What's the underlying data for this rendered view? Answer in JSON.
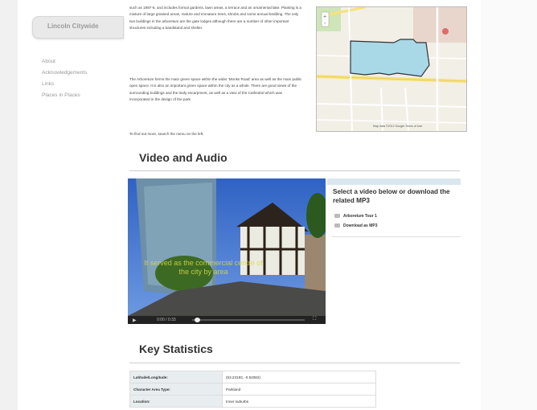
{
  "sidebar": {
    "brand": "Lincoln Citywide",
    "items": [
      {
        "label": "About"
      },
      {
        "label": "Acknowledgements"
      },
      {
        "label": "Links"
      },
      {
        "label": "Places in Places"
      }
    ]
  },
  "intro": {
    "p1": "such as 1997-8, and includes formal gardens, lawn areas, a terrace and an ornamental lake. Planting is a mixture of large grassed areas, mature and immature trees, shrubs and some annual bedding. The only two buildings in the arboretum are the gate lodges although there are a number of other important structures including a bandstand and shelter.",
    "p2": "The Arboretum forms the main green space within the wider 'Monks Road' area as well as the main public open space. It is also an important green space within the city as a whole. There are good views of the surrounding buildings and the leafy escarpment, as well as a view of the Cathedral which was incorporated in the design of the park.",
    "p3": "To find out more, search the menu on the left."
  },
  "map": {
    "attribution": "Map data ©2012 Google  Terms of Use"
  },
  "video_section": {
    "title": "Video and Audio",
    "panel_title": "Select a video below or download the related MP3",
    "items": [
      {
        "label": "Arboretum Tour 1",
        "icon": "video-icon"
      },
      {
        "label": "Download as MP3",
        "icon": "download-icon"
      }
    ],
    "subtitle": "It served as the commercial centre of the city by area",
    "time": "0:00 / 0:33"
  },
  "stats": {
    "title": "Key Statistics",
    "rows": [
      {
        "k": "Latitude/Longitude:",
        "v": "(53.23193, -0.52082)"
      },
      {
        "k": "Character Area Type:",
        "v": "Parkland"
      },
      {
        "k": "Location:",
        "v": "Inner suburbs"
      }
    ]
  },
  "colors": {
    "accent": "#dbe7ee",
    "park_fill": "#a9d8e6",
    "road": "#f7e27a"
  }
}
